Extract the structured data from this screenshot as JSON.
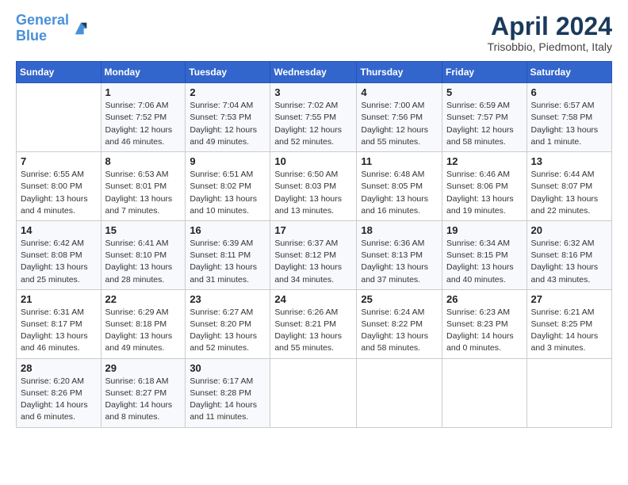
{
  "header": {
    "logo_line1": "General",
    "logo_line2": "Blue",
    "month_title": "April 2024",
    "location": "Trisobbio, Piedmont, Italy"
  },
  "days_of_week": [
    "Sunday",
    "Monday",
    "Tuesday",
    "Wednesday",
    "Thursday",
    "Friday",
    "Saturday"
  ],
  "weeks": [
    [
      {
        "num": "",
        "info": ""
      },
      {
        "num": "1",
        "info": "Sunrise: 7:06 AM\nSunset: 7:52 PM\nDaylight: 12 hours\nand 46 minutes."
      },
      {
        "num": "2",
        "info": "Sunrise: 7:04 AM\nSunset: 7:53 PM\nDaylight: 12 hours\nand 49 minutes."
      },
      {
        "num": "3",
        "info": "Sunrise: 7:02 AM\nSunset: 7:55 PM\nDaylight: 12 hours\nand 52 minutes."
      },
      {
        "num": "4",
        "info": "Sunrise: 7:00 AM\nSunset: 7:56 PM\nDaylight: 12 hours\nand 55 minutes."
      },
      {
        "num": "5",
        "info": "Sunrise: 6:59 AM\nSunset: 7:57 PM\nDaylight: 12 hours\nand 58 minutes."
      },
      {
        "num": "6",
        "info": "Sunrise: 6:57 AM\nSunset: 7:58 PM\nDaylight: 13 hours\nand 1 minute."
      }
    ],
    [
      {
        "num": "7",
        "info": "Sunrise: 6:55 AM\nSunset: 8:00 PM\nDaylight: 13 hours\nand 4 minutes."
      },
      {
        "num": "8",
        "info": "Sunrise: 6:53 AM\nSunset: 8:01 PM\nDaylight: 13 hours\nand 7 minutes."
      },
      {
        "num": "9",
        "info": "Sunrise: 6:51 AM\nSunset: 8:02 PM\nDaylight: 13 hours\nand 10 minutes."
      },
      {
        "num": "10",
        "info": "Sunrise: 6:50 AM\nSunset: 8:03 PM\nDaylight: 13 hours\nand 13 minutes."
      },
      {
        "num": "11",
        "info": "Sunrise: 6:48 AM\nSunset: 8:05 PM\nDaylight: 13 hours\nand 16 minutes."
      },
      {
        "num": "12",
        "info": "Sunrise: 6:46 AM\nSunset: 8:06 PM\nDaylight: 13 hours\nand 19 minutes."
      },
      {
        "num": "13",
        "info": "Sunrise: 6:44 AM\nSunset: 8:07 PM\nDaylight: 13 hours\nand 22 minutes."
      }
    ],
    [
      {
        "num": "14",
        "info": "Sunrise: 6:42 AM\nSunset: 8:08 PM\nDaylight: 13 hours\nand 25 minutes."
      },
      {
        "num": "15",
        "info": "Sunrise: 6:41 AM\nSunset: 8:10 PM\nDaylight: 13 hours\nand 28 minutes."
      },
      {
        "num": "16",
        "info": "Sunrise: 6:39 AM\nSunset: 8:11 PM\nDaylight: 13 hours\nand 31 minutes."
      },
      {
        "num": "17",
        "info": "Sunrise: 6:37 AM\nSunset: 8:12 PM\nDaylight: 13 hours\nand 34 minutes."
      },
      {
        "num": "18",
        "info": "Sunrise: 6:36 AM\nSunset: 8:13 PM\nDaylight: 13 hours\nand 37 minutes."
      },
      {
        "num": "19",
        "info": "Sunrise: 6:34 AM\nSunset: 8:15 PM\nDaylight: 13 hours\nand 40 minutes."
      },
      {
        "num": "20",
        "info": "Sunrise: 6:32 AM\nSunset: 8:16 PM\nDaylight: 13 hours\nand 43 minutes."
      }
    ],
    [
      {
        "num": "21",
        "info": "Sunrise: 6:31 AM\nSunset: 8:17 PM\nDaylight: 13 hours\nand 46 minutes."
      },
      {
        "num": "22",
        "info": "Sunrise: 6:29 AM\nSunset: 8:18 PM\nDaylight: 13 hours\nand 49 minutes."
      },
      {
        "num": "23",
        "info": "Sunrise: 6:27 AM\nSunset: 8:20 PM\nDaylight: 13 hours\nand 52 minutes."
      },
      {
        "num": "24",
        "info": "Sunrise: 6:26 AM\nSunset: 8:21 PM\nDaylight: 13 hours\nand 55 minutes."
      },
      {
        "num": "25",
        "info": "Sunrise: 6:24 AM\nSunset: 8:22 PM\nDaylight: 13 hours\nand 58 minutes."
      },
      {
        "num": "26",
        "info": "Sunrise: 6:23 AM\nSunset: 8:23 PM\nDaylight: 14 hours\nand 0 minutes."
      },
      {
        "num": "27",
        "info": "Sunrise: 6:21 AM\nSunset: 8:25 PM\nDaylight: 14 hours\nand 3 minutes."
      }
    ],
    [
      {
        "num": "28",
        "info": "Sunrise: 6:20 AM\nSunset: 8:26 PM\nDaylight: 14 hours\nand 6 minutes."
      },
      {
        "num": "29",
        "info": "Sunrise: 6:18 AM\nSunset: 8:27 PM\nDaylight: 14 hours\nand 8 minutes."
      },
      {
        "num": "30",
        "info": "Sunrise: 6:17 AM\nSunset: 8:28 PM\nDaylight: 14 hours\nand 11 minutes."
      },
      {
        "num": "",
        "info": ""
      },
      {
        "num": "",
        "info": ""
      },
      {
        "num": "",
        "info": ""
      },
      {
        "num": "",
        "info": ""
      }
    ]
  ]
}
